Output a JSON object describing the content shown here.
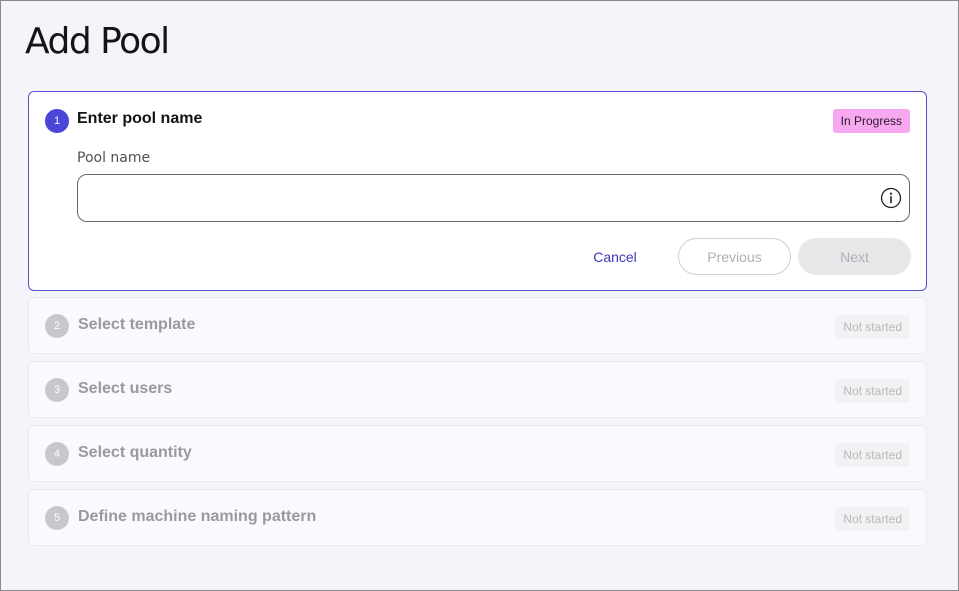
{
  "page": {
    "title": "Add Pool"
  },
  "steps": [
    {
      "number": "1",
      "title": "Enter pool name",
      "status": "In Progress",
      "field_label": "Pool name",
      "field_value": "",
      "field_placeholder": "",
      "buttons": {
        "cancel": "Cancel",
        "previous": "Previous",
        "next": "Next"
      },
      "icon": "info-icon"
    },
    {
      "number": "2",
      "title": "Select template",
      "status": "Not started"
    },
    {
      "number": "3",
      "title": "Select users",
      "status": "Not started"
    },
    {
      "number": "4",
      "title": "Select quantity",
      "status": "Not started"
    },
    {
      "number": "5",
      "title": "Define machine naming pattern",
      "status": "Not started"
    }
  ],
  "colors": {
    "accent": "#4b45d8",
    "in_progress_badge": "#f7a8f0",
    "cancel_link": "#3d38b8"
  }
}
